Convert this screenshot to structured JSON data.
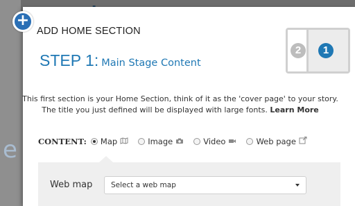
{
  "background": {
    "logo_text": "esri",
    "left_letter": "e"
  },
  "dialog": {
    "add_icon_glyph": "+",
    "title": "ADD HOME SECTION",
    "step_number": "STEP 1:",
    "step_name": "Main Stage Content",
    "layout": {
      "badge_left": "2",
      "badge_right": "1"
    },
    "description": "This first section is your Home Section, think of it as the 'cover page' to your story. The title you just defined will be displayed with large fonts.",
    "learn_more": "Learn More",
    "content_label": "CONTENT:",
    "content_options": [
      {
        "label": "Map",
        "checked": true,
        "icon": "map-icon"
      },
      {
        "label": "Image",
        "checked": false,
        "icon": "camera-icon"
      },
      {
        "label": "Video",
        "checked": false,
        "icon": "video-icon"
      },
      {
        "label": "Web page",
        "checked": false,
        "icon": "external-link-icon"
      }
    ],
    "webmap_label": "Web map",
    "webmap_select": "Select a web map"
  },
  "colors": {
    "accent": "#1f78b4",
    "add_button": "#2a6fb5",
    "panel_bg": "#efefef"
  }
}
